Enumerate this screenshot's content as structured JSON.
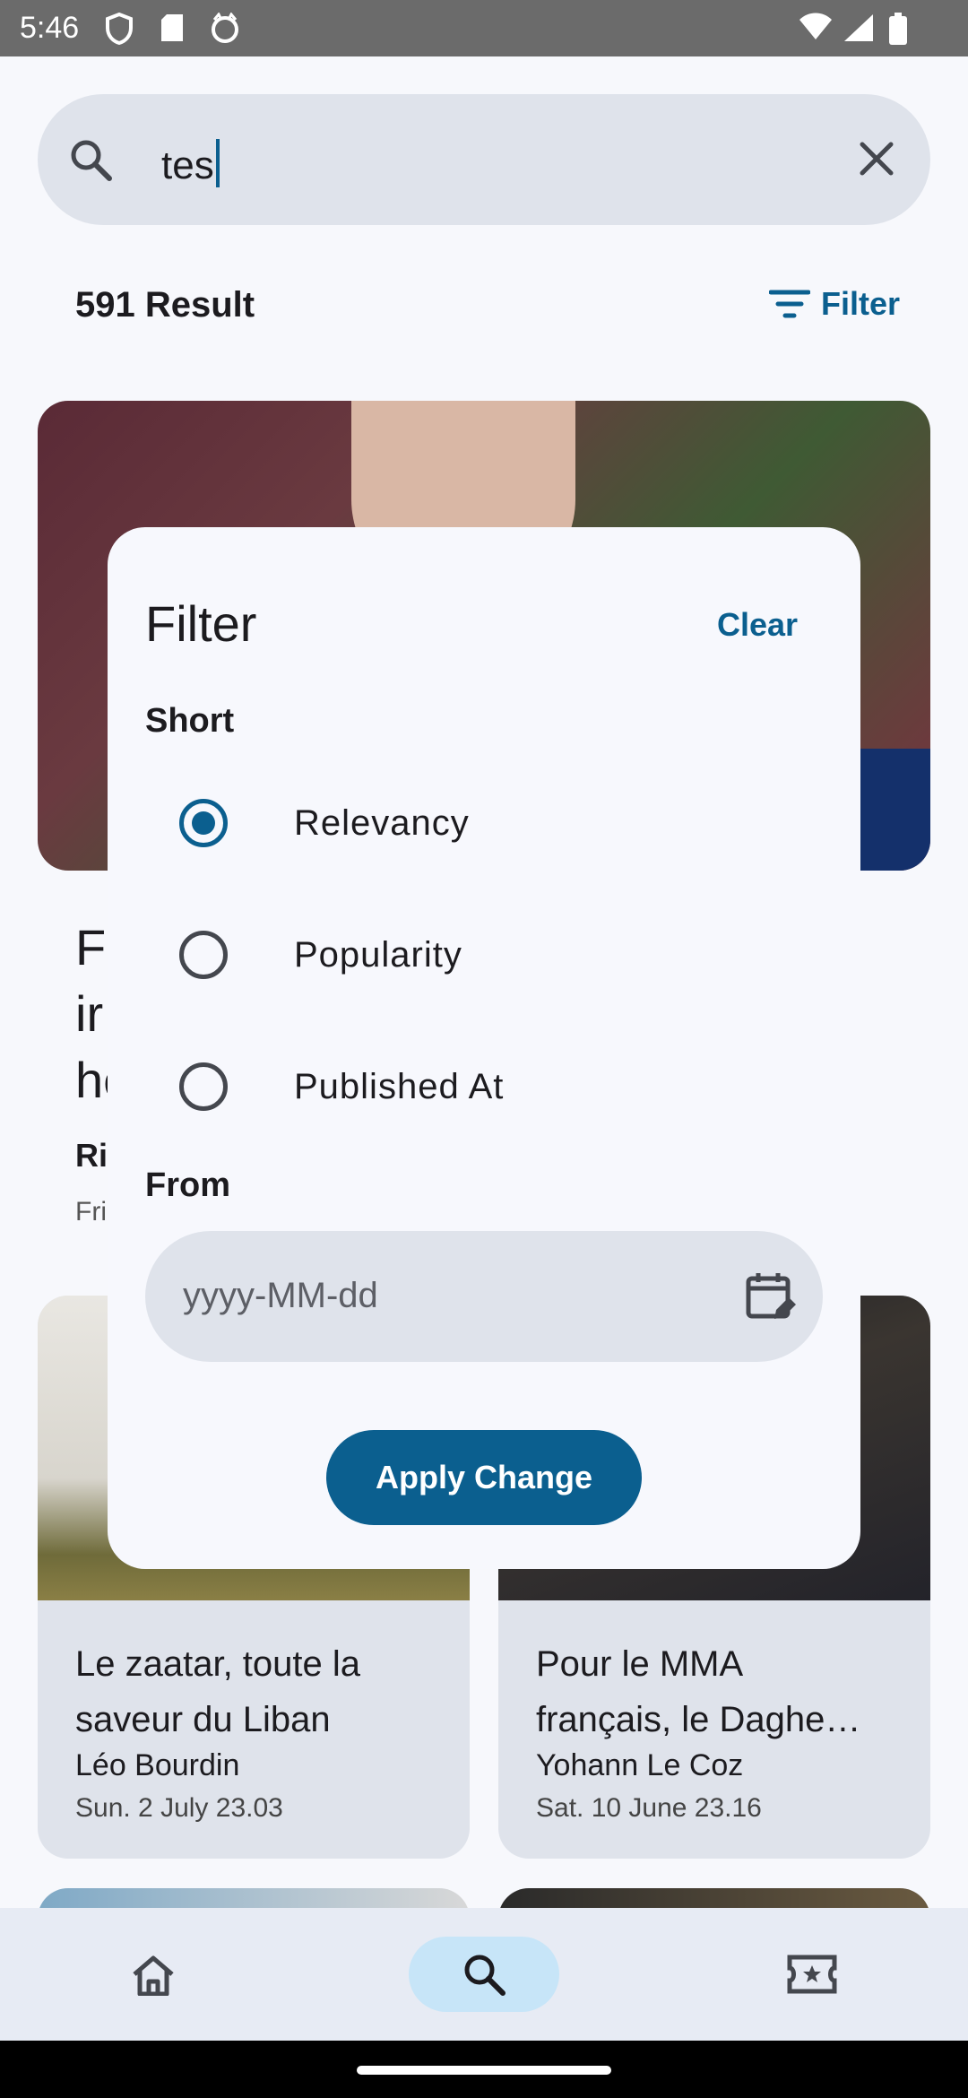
{
  "status_bar": {
    "time": "5:46"
  },
  "search": {
    "query": "tes"
  },
  "results": {
    "count_label": "591 Result",
    "filter_label": "Filter"
  },
  "background": {
    "headline_fragment": "Fc\nir\nhe",
    "author_fragment": "Ri",
    "date_fragment": "Fri",
    "cards": [
      {
        "title": "Le zaatar, toute la saveur du Liban",
        "author": "Léo Bourdin",
        "date": "Sun. 2 July 23.03"
      },
      {
        "title": "Pour le MMA français, le Daghe…",
        "author": "Yohann Le Coz",
        "date": "Sat. 10 June 23.16"
      }
    ]
  },
  "dialog": {
    "title": "Filter",
    "clear_label": "Clear",
    "sort_section": "Short",
    "options": [
      {
        "label": "Relevancy",
        "selected": true
      },
      {
        "label": "Popularity",
        "selected": false
      },
      {
        "label": "Published At",
        "selected": false
      }
    ],
    "from_label": "From",
    "date_placeholder": "yyyy-MM-dd",
    "apply_label": "Apply Change"
  },
  "nav": {
    "items": [
      "home-icon",
      "search-icon",
      "ticket-icon"
    ],
    "active": "search"
  },
  "colors": {
    "accent": "#0b5f8f",
    "field_bg": "#dfe3eb",
    "nav_active": "#c7e5f8"
  }
}
